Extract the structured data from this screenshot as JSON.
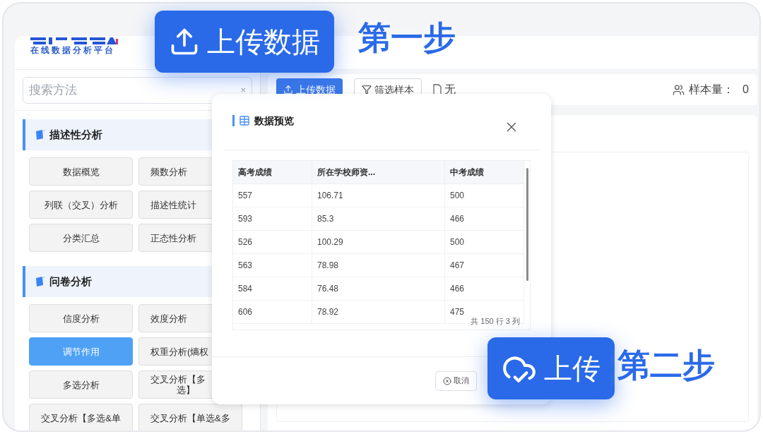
{
  "logo": {
    "subtitle": "在线数据分析平台"
  },
  "search": {
    "placeholder": "搜索方法",
    "clear": "×"
  },
  "sections": [
    {
      "title": "描述性分析",
      "methods": [
        {
          "label": "数据概览",
          "selected": false
        },
        {
          "label": "频数分析",
          "selected": false
        },
        {
          "label": "列联（交叉）分析",
          "selected": false
        },
        {
          "label": "描述性统计",
          "selected": false
        },
        {
          "label": "分类汇总",
          "selected": false
        },
        {
          "label": "正态性分析",
          "selected": false
        }
      ]
    },
    {
      "title": "问卷分析",
      "methods": [
        {
          "label": "信度分析",
          "selected": false
        },
        {
          "label": "效度分析",
          "selected": false
        },
        {
          "label": "调节作用",
          "selected": true
        },
        {
          "label": "权重分析(熵权",
          "selected": false
        },
        {
          "label": "多选分析",
          "selected": false
        },
        {
          "label": "交叉分析【多",
          "label_2": "选】",
          "selected": false
        },
        {
          "label": "交叉分析【多选&单",
          "selected": false
        },
        {
          "label": "交叉分析【单选&多",
          "selected": false
        }
      ]
    }
  ],
  "toolbar": {
    "upload": "上传数据",
    "filter": "筛选样本",
    "file": "无",
    "sample_label": "样本量：",
    "sample_count": "0"
  },
  "modal": {
    "title": "数据预览",
    "columns": [
      "高考成绩",
      "所在学校师资...",
      "中考成绩"
    ],
    "rows": [
      [
        "557",
        "106.71",
        "500"
      ],
      [
        "593",
        "85.3",
        "466"
      ],
      [
        "526",
        "100.29",
        "500"
      ],
      [
        "563",
        "78.98",
        "467"
      ],
      [
        "584",
        "76.48",
        "466"
      ],
      [
        "606",
        "78.92",
        "475"
      ]
    ],
    "summary": "共 150 行 3 列",
    "cancel": "取消"
  },
  "callouts": [
    {
      "kind": "upload",
      "button": "上传数据",
      "step": "第一步"
    },
    {
      "kind": "cloud",
      "button": "上传",
      "step": "第二步"
    }
  ]
}
